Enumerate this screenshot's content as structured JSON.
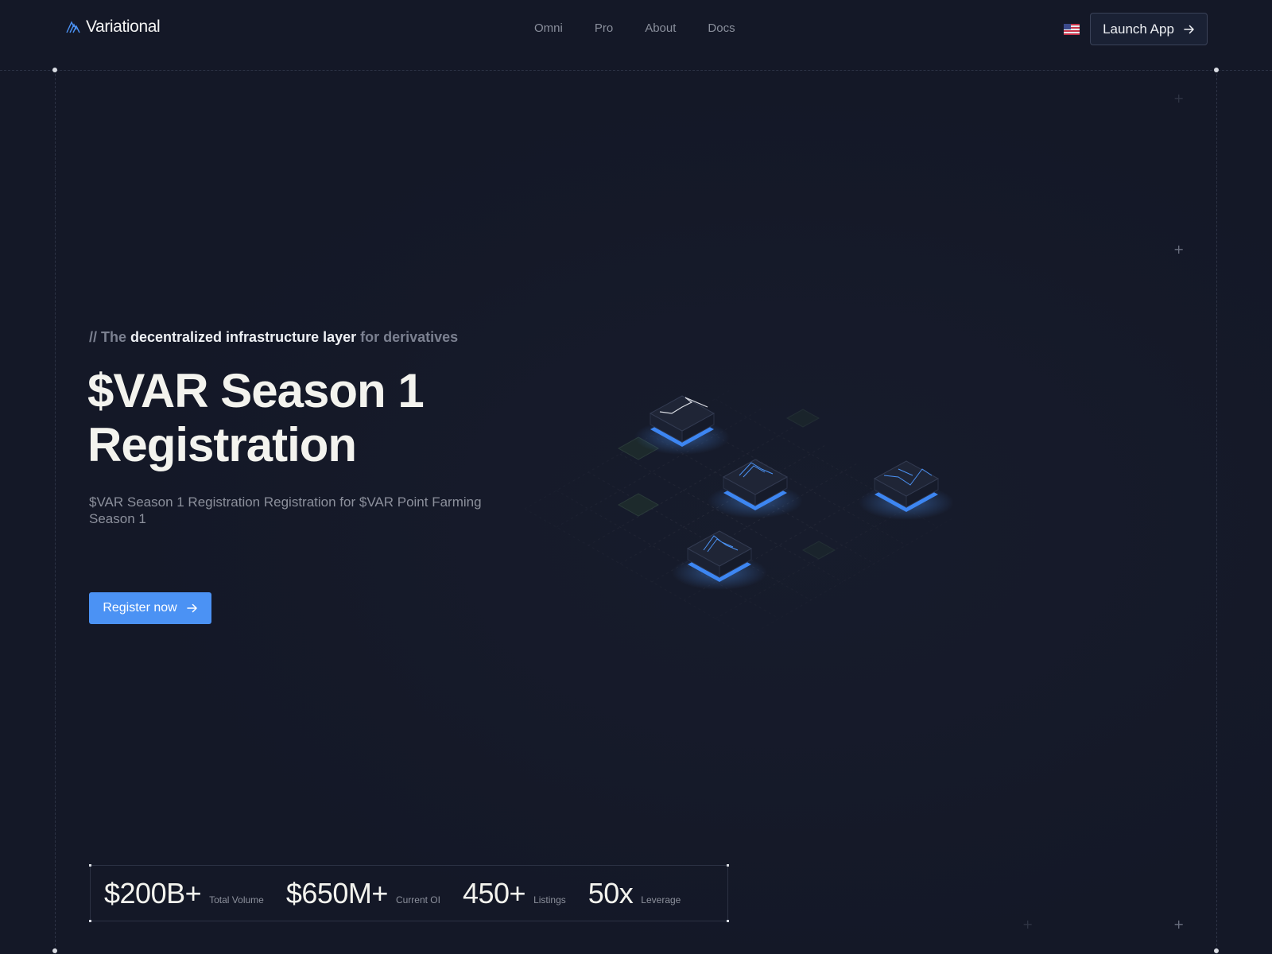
{
  "header": {
    "logo_text": "Variational",
    "nav": [
      "Omni",
      "Pro",
      "About",
      "Docs"
    ],
    "language_icon": "us-flag-icon",
    "launch_label": "Launch App"
  },
  "hero": {
    "tagline_prefix": "// The ",
    "tagline_highlight": "decentralized infrastructure layer",
    "tagline_suffix": " for derivatives",
    "title": "$VAR Season 1 Registration",
    "subtitle": "$VAR Season 1 Registration Registration for $VAR Point Farming Season 1",
    "cta_label": "Register now"
  },
  "stats": [
    {
      "value": "$200B+",
      "label": "Total Volume"
    },
    {
      "value": "$650M+",
      "label": "Current OI"
    },
    {
      "value": "450+",
      "label": "Listings"
    },
    {
      "value": "50x",
      "label": "Leverage"
    }
  ],
  "colors": {
    "background": "#141827",
    "accent": "#4b92f4",
    "text_primary": "#f3f3ee",
    "text_muted": "#8c909c"
  }
}
